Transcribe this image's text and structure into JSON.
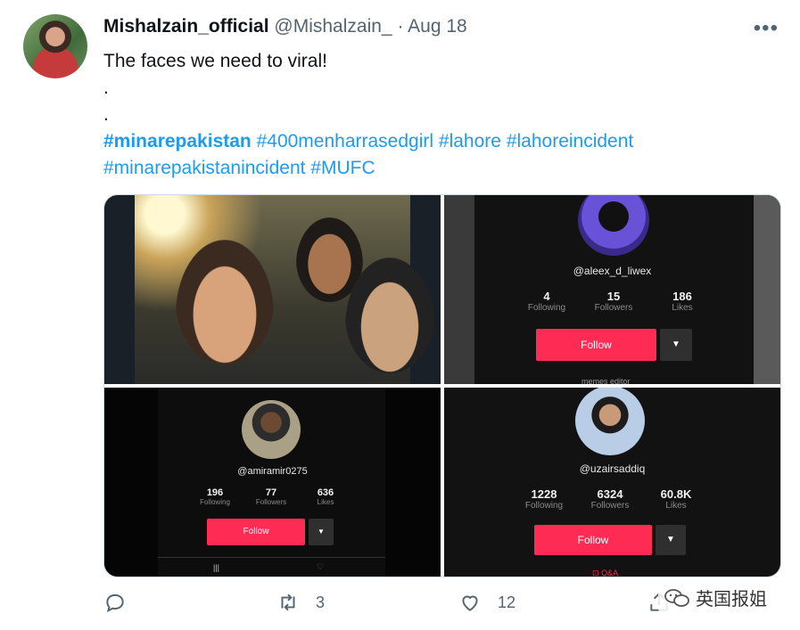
{
  "tweet": {
    "display_name": "Mishalzain_official",
    "handle": "@Mishalzain_",
    "separator": "·",
    "date": "Aug 18",
    "more_label": "•••",
    "text_line1": "The faces we need to viral!",
    "text_dot1": ".",
    "text_dot2": ".",
    "hashtags_line1": [
      "#minarepakistan",
      "#400menharrasedgirl",
      "#lahore",
      "#lahoreincident"
    ],
    "hashtags_line2": [
      "#minarepakistanincident",
      "#MUFC"
    ]
  },
  "media": {
    "profile2": {
      "username": "@aleex_d_liwex",
      "following": "4",
      "following_label": "Following",
      "followers": "15",
      "followers_label": "Followers",
      "likes": "186",
      "likes_label": "Likes",
      "follow_label": "Follow",
      "dropdown": "▼",
      "bio": "memes editor"
    },
    "profile3": {
      "username": "@amiramir0275",
      "following": "196",
      "following_label": "Following",
      "followers": "77",
      "followers_label": "Followers",
      "likes": "636",
      "likes_label": "Likes",
      "follow_label": "Follow",
      "dropdown": "▼",
      "tab_icon1": "|||",
      "tab_icon2": "♡"
    },
    "profile4": {
      "username": "@uzairsaddiq",
      "following": "1228",
      "following_label": "Following",
      "followers": "6324",
      "followers_label": "Followers",
      "likes": "60.8K",
      "likes_label": "Likes",
      "follow_label": "Follow",
      "dropdown": "▼",
      "qa_label": "Q&A"
    }
  },
  "actions": {
    "reply_count": "",
    "retweet_count": "3",
    "like_count": "12"
  },
  "watermark": {
    "text": "英国报姐"
  },
  "colors": {
    "link": "#1d9bf0",
    "tiktok_red": "#fe2c55",
    "muted": "#536471"
  }
}
